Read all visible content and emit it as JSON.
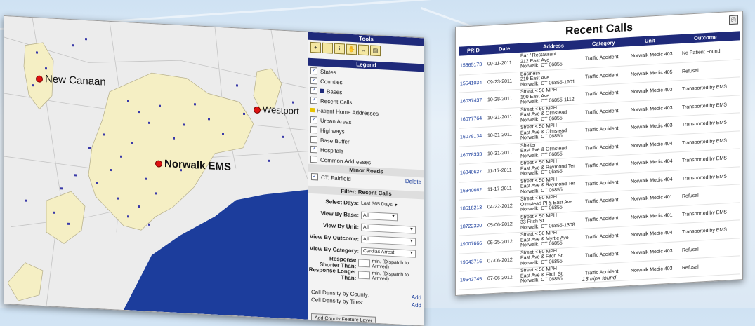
{
  "map": {
    "places": {
      "new_canaan": "New Canaan",
      "westport": "Westport",
      "norwalk": "Norwalk EMS"
    },
    "colors": {
      "land": "#f5efc4",
      "water": "#1c3d9c",
      "background": "#ececec",
      "marker": "#3a3aa8"
    }
  },
  "tools": {
    "title": "Tools",
    "buttons": [
      "zoom-in",
      "zoom-out",
      "identify",
      "pan",
      "measure",
      "print"
    ]
  },
  "legend": {
    "title": "Legend",
    "items": [
      {
        "label": "States",
        "checked": true
      },
      {
        "label": "Counties",
        "checked": true
      },
      {
        "label": "Bases",
        "checked": true,
        "swatch": "#1f2a7a"
      },
      {
        "label": "Recent Calls",
        "checked": true
      },
      {
        "label": "Patient Home Addresses",
        "checked": false,
        "swatch": "#e6c200"
      },
      {
        "label": "Urban Areas",
        "checked": true
      },
      {
        "label": "Highways",
        "checked": false
      },
      {
        "label": "Base Buffer",
        "checked": false
      },
      {
        "label": "Hospitals",
        "checked": true
      },
      {
        "label": "Common Addresses",
        "checked": false
      }
    ],
    "minor_roads": {
      "title": "Minor Roads",
      "item": "CT: Fairfield",
      "action": "Delete"
    }
  },
  "filter": {
    "title": "Filter: Recent Calls",
    "select_days": {
      "label": "Select Days:",
      "value": "Last 365 Days"
    },
    "by_base": {
      "label": "View By Base:",
      "value": "All"
    },
    "by_unit": {
      "label": "View By Unit:",
      "value": "All"
    },
    "by_outcome": {
      "label": "View By Outcome:",
      "value": "All"
    },
    "by_category": {
      "label": "View By Category:",
      "value": "Cardiac Arrest"
    },
    "shorter": {
      "label": "Response Shorter Than:",
      "suffix": "min. (Dispatch to Arrived)"
    },
    "longer": {
      "label": "Response Longer Than:",
      "suffix": "min. (Dispatch to Arrived)"
    },
    "density_county": "Call Density by County:",
    "density_tiles": "Cell Density by Tiles:",
    "add": "Add",
    "add_layer_button": "Add County Feature Layer"
  },
  "recent_calls": {
    "title": "Recent Calls",
    "columns": [
      "PRID",
      "Date",
      "Address",
      "Category",
      "Unit",
      "Outcome"
    ],
    "rows": [
      {
        "id": "15365173",
        "date": "09-11-2011",
        "address": "Bar / Restaurant\n212 East Ave\nNorwalk, CT 06855",
        "category": "Traffic Accident",
        "unit": "Norwalk Medic 403",
        "outcome": "No Patient Found"
      },
      {
        "id": "15541034",
        "date": "09-23-2011",
        "address": "Business\n219 East Ave\nNorwalk, CT 06855-1901",
        "category": "Traffic Accident",
        "unit": "Norwalk Medic 405",
        "outcome": "Refusal"
      },
      {
        "id": "16037437",
        "date": "10-28-2011",
        "address": "Street < 50 MPH\n190 East Ave\nNorwalk, CT 06855-1112",
        "category": "Traffic Accident",
        "unit": "Norwalk Medic 403",
        "outcome": "Transported by EMS"
      },
      {
        "id": "16077764",
        "date": "10-31-2011",
        "address": "Street < 50 MPH\nEast Ave & Olmstead\nNorwalk, CT 06855",
        "category": "Traffic Accident",
        "unit": "Norwalk Medic 403",
        "outcome": "Transported by EMS"
      },
      {
        "id": "16078134",
        "date": "10-31-2011",
        "address": "Street < 50 MPH\nEast Ave & Olmstead\nNorwalk, CT 06855",
        "category": "Traffic Accident",
        "unit": "Norwalk Medic 403",
        "outcome": "Transported by EMS"
      },
      {
        "id": "16078333",
        "date": "10-31-2011",
        "address": "Shelter\nEast Ave & Olmstead\nNorwalk, CT 06855",
        "category": "Traffic Accident",
        "unit": "Norwalk Medic 404",
        "outcome": "Transported by EMS"
      },
      {
        "id": "16340627",
        "date": "11-17-2011",
        "address": "Street < 50 MPH\nEast Ave & Raymond Ter\nNorwalk, CT 06855",
        "category": "Traffic Accident",
        "unit": "Norwalk Medic 404",
        "outcome": "Transported by EMS"
      },
      {
        "id": "16340662",
        "date": "11-17-2011",
        "address": "Street < 50 MPH\nEast Ave & Raymond Ter\nNorwalk, CT 06855",
        "category": "Traffic Accident",
        "unit": "Norwalk Medic 404",
        "outcome": "Transported by EMS"
      },
      {
        "id": "18518213",
        "date": "04-22-2012",
        "address": "Street < 50 MPH\nOlmstead Pl & East Ave\nNorwalk, CT 06855",
        "category": "Traffic Accident",
        "unit": "Norwalk Medic 401",
        "outcome": "Refusal"
      },
      {
        "id": "18722320",
        "date": "05-06-2012",
        "address": "Street < 50 MPH\n33 Fitch St\nNorwalk, CT 06855-1308",
        "category": "Traffic Accident",
        "unit": "Norwalk Medic 401",
        "outcome": "Transported by EMS"
      },
      {
        "id": "19007666",
        "date": "05-25-2012",
        "address": "Street < 50 MPH\nEast Ave & Myrtle Ave\nNorwalk, CT 06855",
        "category": "Traffic Accident",
        "unit": "Norwalk Medic 404",
        "outcome": "Transported by EMS"
      },
      {
        "id": "19643716",
        "date": "07-06-2012",
        "address": "Street < 50 MPH\nEast Ave & Fitch St.\nNorwalk, CT 06855",
        "category": "Traffic Accident",
        "unit": "Norwalk Medic 403",
        "outcome": "Refusal"
      },
      {
        "id": "19643745",
        "date": "07-06-2012",
        "address": "Street < 50 MPH\nEast Ave & Fitch St.\nNorwalk, CT 06855",
        "category": "Traffic Accident",
        "unit": "Norwalk Medic 403",
        "outcome": "Refusal"
      }
    ],
    "footer": "13 trips found"
  }
}
